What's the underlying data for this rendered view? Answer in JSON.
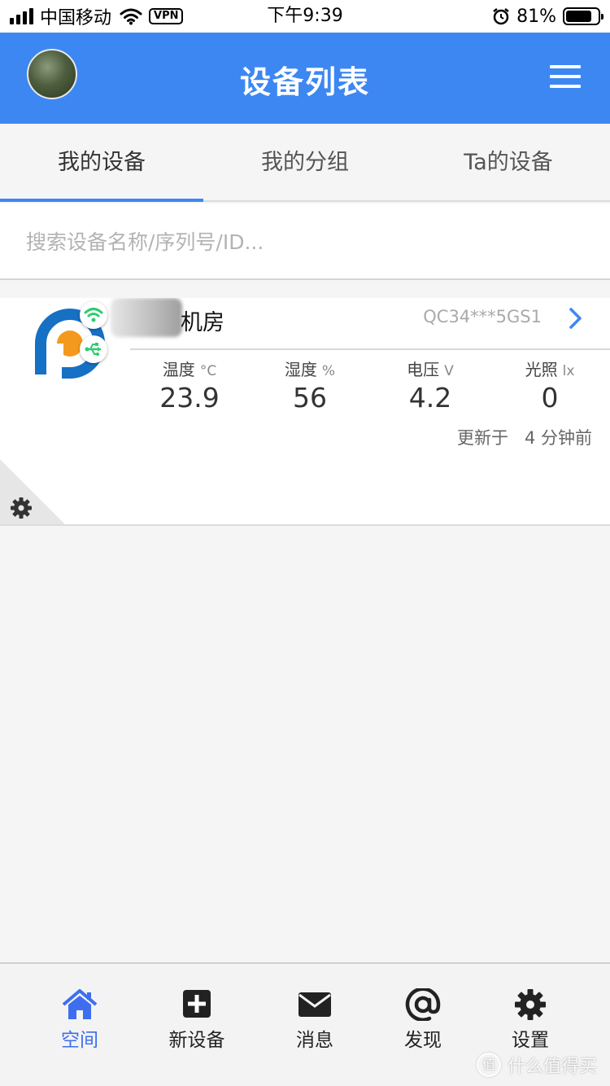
{
  "status_bar": {
    "carrier": "中国移动",
    "vpn": "VPN",
    "time": "下午9:39",
    "battery_pct": "81%",
    "battery_level": 0.81,
    "icons": [
      "signal-icon",
      "wifi-icon",
      "alarm-icon",
      "battery-icon"
    ]
  },
  "header": {
    "title": "设备列表",
    "icons": [
      "avatar",
      "menu-icon"
    ]
  },
  "tabs": [
    {
      "label": "我的设备",
      "active": true
    },
    {
      "label": "我的分组",
      "active": false
    },
    {
      "label": "Ta的设备",
      "active": false
    }
  ],
  "search": {
    "placeholder": "搜索设备名称/序列号/ID..."
  },
  "device": {
    "name": "机房",
    "serial": "QC34***5GS1",
    "metrics": [
      {
        "label": "温度",
        "unit": "°C",
        "value": "23.9"
      },
      {
        "label": "湿度",
        "unit": "%",
        "value": "56"
      },
      {
        "label": "电压",
        "unit": "V",
        "value": "4.2"
      },
      {
        "label": "光照",
        "unit": "lx",
        "value": "0"
      }
    ],
    "updated_prefix": "更新于",
    "updated_value": "4 分钟前",
    "icons": [
      "device-logo-icon",
      "wifi-icon",
      "usb-icon",
      "chevron-right-icon",
      "gear-icon"
    ]
  },
  "bottom_nav": [
    {
      "label": "空间",
      "icon": "home-icon",
      "active": true
    },
    {
      "label": "新设备",
      "icon": "plus-icon",
      "active": false
    },
    {
      "label": "消息",
      "icon": "mail-icon",
      "active": false
    },
    {
      "label": "发现",
      "icon": "at-icon",
      "active": false
    },
    {
      "label": "设置",
      "icon": "gear-icon",
      "active": false
    }
  ],
  "watermark": {
    "symbol": "值",
    "text": "什么值得买"
  },
  "colors": {
    "primary": "#3d87f2",
    "nav_active": "#3d6ef0",
    "logo_blue": "#1670c4",
    "logo_orange": "#f39a1e",
    "badge_green": "#2ecc71"
  }
}
